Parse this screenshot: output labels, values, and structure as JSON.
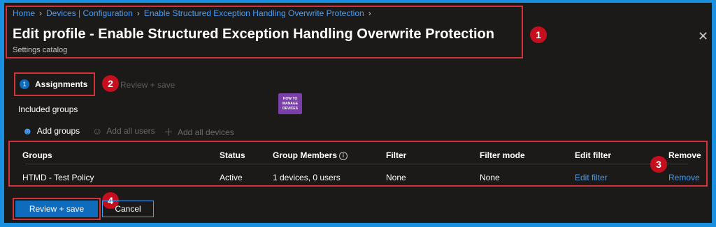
{
  "breadcrumb": [
    "Home",
    "Devices | Configuration",
    "Enable Structured Exception Handling Overwrite Protection"
  ],
  "header": {
    "title": "Edit profile - Enable Structured Exception Handling Overwrite Protection",
    "subtitle": "Settings catalog",
    "close_icon": "close-icon"
  },
  "steps": [
    {
      "number": "1",
      "label": "Assignments",
      "active": true
    },
    {
      "label": "Review + save",
      "active": false
    }
  ],
  "logo": {
    "line1": "HOW TO",
    "line2": "MANAGE",
    "line3": "DEVICES"
  },
  "section": {
    "label": "Included groups"
  },
  "actions": [
    {
      "label": "Add groups",
      "icon": "add-person-icon",
      "enabled": true
    },
    {
      "label": "Add all users",
      "icon": "people-icon",
      "enabled": false
    },
    {
      "label": "Add all devices",
      "icon": "plus-icon",
      "enabled": false
    }
  ],
  "table": {
    "headers": [
      "Groups",
      "Status",
      "Group Members",
      "Filter",
      "Filter mode",
      "Edit filter",
      "Remove"
    ],
    "rows": [
      {
        "group": "HTMD - Test Policy",
        "status": "Active",
        "members": "1 devices, 0 users",
        "filter": "None",
        "filter_mode": "None",
        "edit_filter": "Edit filter",
        "remove": "Remove"
      }
    ]
  },
  "footer": {
    "primary": "Review + save",
    "secondary": "Cancel"
  },
  "annotations": [
    "1",
    "2",
    "3",
    "4"
  ],
  "colors": {
    "accent": "#0f6cbd",
    "link": "#479ef5",
    "highlight": "#d13438",
    "background": "#1b1a19",
    "frame": "#1a8fe0"
  }
}
